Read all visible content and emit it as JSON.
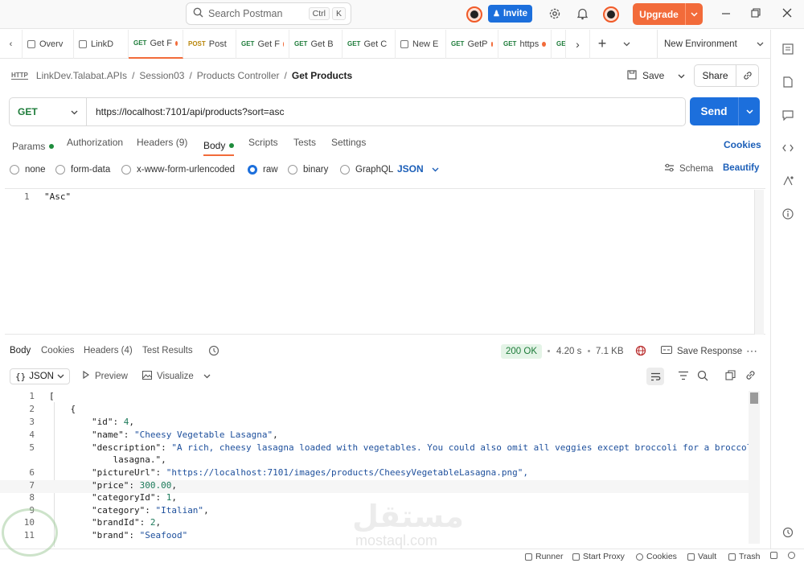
{
  "titlebar": {
    "search_placeholder": "Search Postman",
    "shortcut_ctrl": "Ctrl",
    "shortcut_k": "K",
    "invite_label": "Invite",
    "upgrade_label": "Upgrade"
  },
  "tabs": [
    {
      "method": "",
      "label": "Overv",
      "dot": false
    },
    {
      "method": "",
      "label": "LinkD",
      "dot": false
    },
    {
      "method": "GET",
      "label": "Get F",
      "dot": true,
      "active": true
    },
    {
      "method": "POST",
      "label": "Post",
      "dot": false
    },
    {
      "method": "GET",
      "label": "Get F",
      "dot": true
    },
    {
      "method": "GET",
      "label": "Get B",
      "dot": false
    },
    {
      "method": "GET",
      "label": "Get C",
      "dot": false
    },
    {
      "method": "",
      "label": "New E",
      "dot": false
    },
    {
      "method": "GET",
      "label": "GetP",
      "dot": true
    },
    {
      "method": "GET",
      "label": "https",
      "dot": true
    },
    {
      "method": "GE",
      "label": "",
      "dot": false
    }
  ],
  "environment": "New Environment",
  "breadcrumb": {
    "badge": "HTTP",
    "collection": "LinkDev.Talabat.APIs",
    "folder1": "Session03",
    "folder2": "Products Controller",
    "current": "Get Products"
  },
  "actions": {
    "save": "Save",
    "share": "Share"
  },
  "request": {
    "method": "GET",
    "url": "https://localhost:7101/api/products?sort=asc",
    "send": "Send"
  },
  "request_tabs": {
    "params": "Params",
    "authorization": "Authorization",
    "headers": "Headers (9)",
    "body": "Body",
    "scripts": "Scripts",
    "tests": "Tests",
    "settings": "Settings",
    "cookies": "Cookies"
  },
  "body_types": {
    "none": "none",
    "form_data": "form-data",
    "urlencoded": "x-www-form-urlencoded",
    "raw": "raw",
    "binary": "binary",
    "graphql": "GraphQL",
    "selected_format": "JSON",
    "schema": "Schema",
    "beautify": "Beautify"
  },
  "request_body": {
    "line": "1",
    "content": "\"Asc\""
  },
  "response_tabs": {
    "body": "Body",
    "cookies": "Cookies",
    "headers": "Headers (4)",
    "test_results": "Test Results"
  },
  "response_meta": {
    "status": "200 OK",
    "time": "4.20 s",
    "size": "7.1 KB",
    "save_response": "Save Response"
  },
  "response_toolbar": {
    "format": "JSON",
    "preview": "Preview",
    "visualize": "Visualize"
  },
  "response_lines": [
    {
      "n": "1",
      "text": "["
    },
    {
      "n": "2",
      "text": "    {"
    },
    {
      "n": "3",
      "text": "        \"id\": 4,"
    },
    {
      "n": "4",
      "text": "        \"name\": \"Cheesy Vegetable Lasagna\","
    },
    {
      "n": "5",
      "text": "        \"description\": \"A rich, cheesy lasagna loaded with vegetables. You could also omit all veggies except broccoli for a broccoli"
    },
    {
      "n": "",
      "text": "            lasagna.\","
    },
    {
      "n": "6",
      "text": "        \"pictureUrl\": \"https://localhost:7101/images/products/CheesyVegetableLasagna.png\","
    },
    {
      "n": "7",
      "text": "        \"price\": 300.00,"
    },
    {
      "n": "8",
      "text": "        \"categoryId\": 1,"
    },
    {
      "n": "9",
      "text": "        \"category\": \"Italian\","
    },
    {
      "n": "10",
      "text": "        \"brandId\": 2,"
    },
    {
      "n": "11",
      "text": "        \"brand\": \"Seafood\""
    }
  ],
  "footer": {
    "runner": "Runner",
    "start_proxy": "Start Proxy",
    "cookies": "Cookies",
    "vault": "Vault",
    "trash": "Trash"
  },
  "watermark": {
    "arabic": "مستقل",
    "latin": "mostaql.com"
  },
  "colors": {
    "accent": "#f26b3a",
    "primary": "#1c6fdc",
    "success": "#1e7c3a"
  }
}
